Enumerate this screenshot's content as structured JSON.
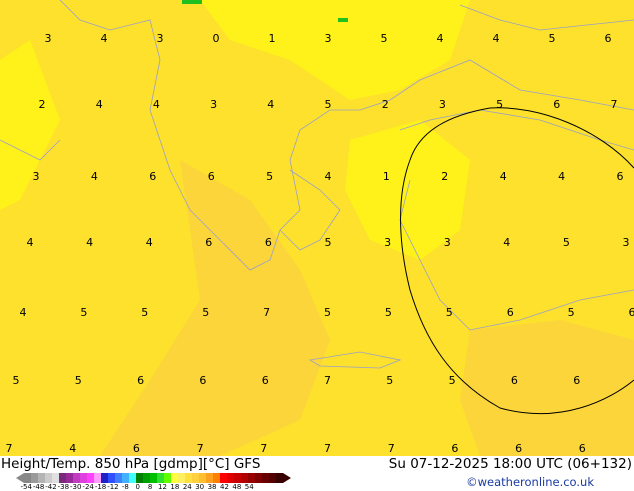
{
  "title": "Height/Temp. 850 hPa [gdmp][°C] GFS",
  "datetime": "Su 07-12-2025 18:00 UTC (06+132)",
  "credit": "©weatheronline.co.uk",
  "colors": {
    "base": "#fde12c",
    "light": "#fff21a",
    "warm": "#fcd53a",
    "contour": "#000000",
    "coast": "#9aa0c8"
  },
  "legend": {
    "colors": [
      "#888888",
      "#9a9a9a",
      "#b4b4b4",
      "#cccccc",
      "#e0e0e0",
      "#7a2a7a",
      "#9a2a9a",
      "#c03cc0",
      "#e040e0",
      "#ff40ff",
      "#ff9cff",
      "#2020c8",
      "#3050ff",
      "#4080ff",
      "#40b0ff",
      "#40ffff",
      "#008000",
      "#00a000",
      "#00c000",
      "#30e030",
      "#60ff00",
      "#ffff40",
      "#fff060",
      "#ffe040",
      "#ffd040",
      "#ffc030",
      "#ffa020",
      "#ff8000",
      "#ff0000",
      "#e00000",
      "#c80000",
      "#b00000",
      "#980000",
      "#800000",
      "#680000",
      "#500000",
      "#380000"
    ],
    "ticks": [
      "-54",
      "-48",
      "-42",
      "-38",
      "-30",
      "-24",
      "-18",
      "-12",
      "-8",
      "0",
      "8",
      "12",
      "18",
      "24",
      "30",
      "38",
      "42",
      "48",
      "54"
    ]
  },
  "labels": [
    3,
    4,
    3,
    0,
    1,
    3,
    5,
    4,
    4,
    5,
    6,
    2,
    4,
    4,
    3,
    4,
    5,
    2,
    3,
    5,
    6,
    7,
    3,
    4,
    6,
    6,
    5,
    4,
    1,
    2,
    4,
    4,
    6,
    4,
    4,
    4,
    6,
    6,
    5,
    3,
    3,
    4,
    5,
    3,
    4,
    5,
    5,
    5,
    7,
    5,
    5,
    5,
    6,
    5,
    6,
    5,
    5,
    6,
    6,
    6,
    7,
    5,
    5,
    6,
    6,
    7,
    4,
    6,
    7,
    7,
    7,
    7,
    6,
    6,
    6
  ]
}
